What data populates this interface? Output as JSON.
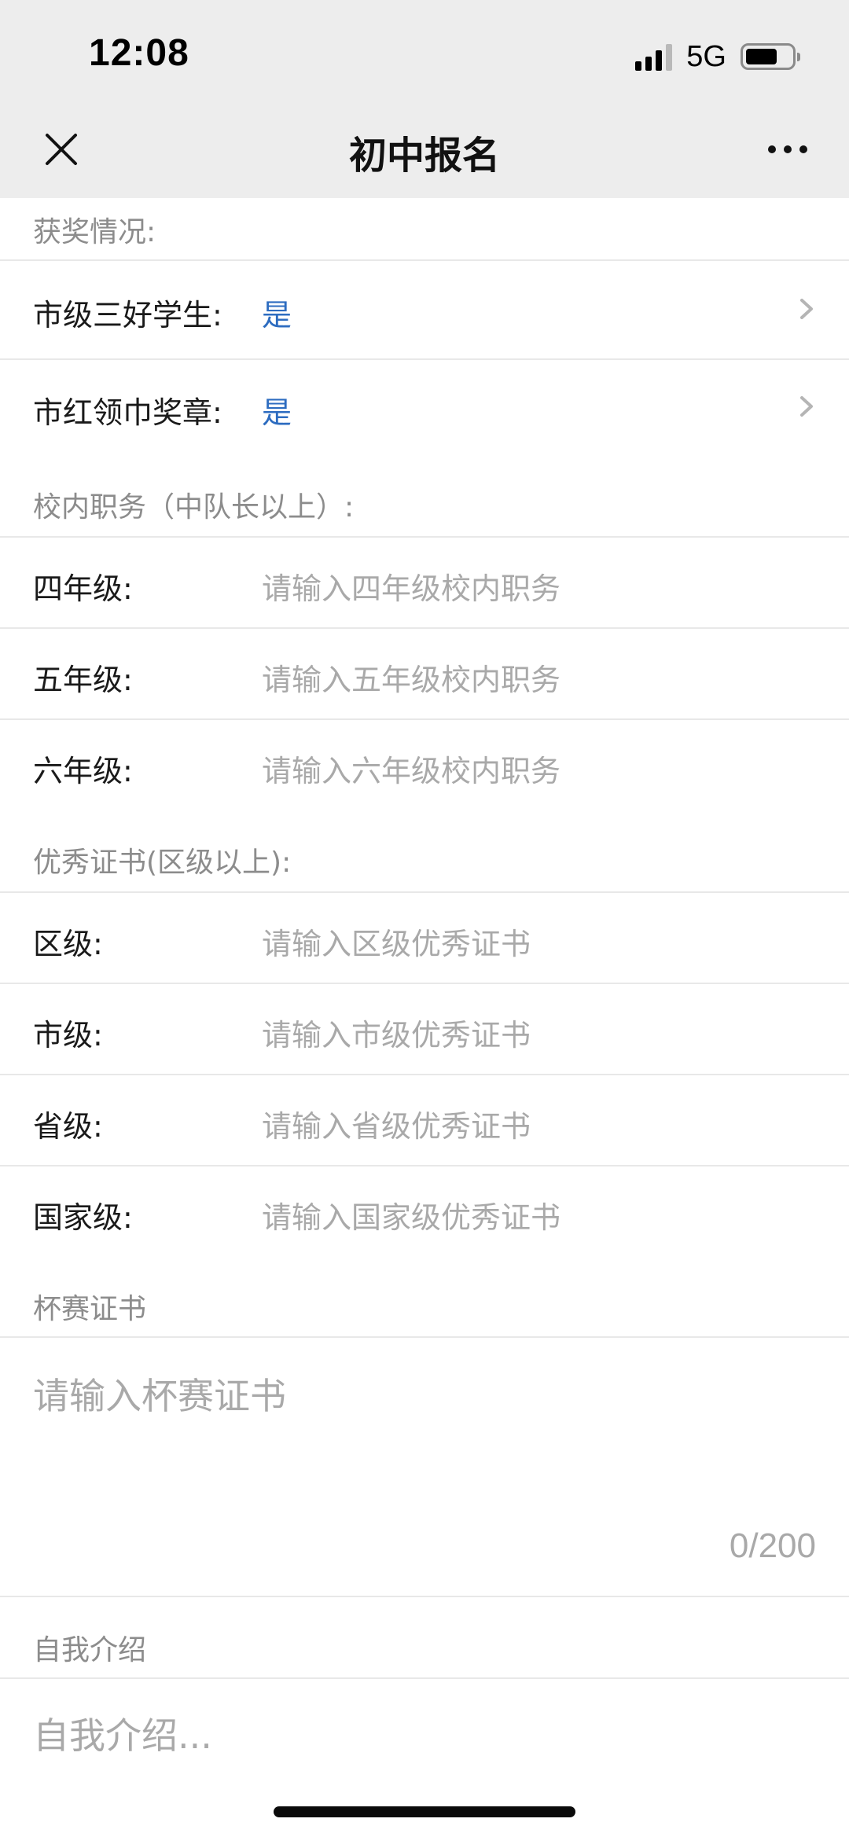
{
  "status_bar": {
    "time": "12:08",
    "network": "5G",
    "battery_level": 0.7
  },
  "nav": {
    "title": "初中报名",
    "close_icon": "close-icon",
    "more_icon": "more-icon"
  },
  "awards": {
    "header": "获奖情况:",
    "rows": [
      {
        "label": "市级三好学生:",
        "value": "是"
      },
      {
        "label": "市红领巾奖章:",
        "value": "是"
      }
    ]
  },
  "duties": {
    "header": "校内职务（中队长以上）:",
    "rows": [
      {
        "label": "四年级:",
        "placeholder": "请输入四年级校内职务"
      },
      {
        "label": "五年级:",
        "placeholder": "请输入五年级校内职务"
      },
      {
        "label": "六年级:",
        "placeholder": "请输入六年级校内职务"
      }
    ]
  },
  "certificates": {
    "header": "优秀证书(区级以上):",
    "rows": [
      {
        "label": "区级:",
        "placeholder": "请输入区级优秀证书"
      },
      {
        "label": "市级:",
        "placeholder": "请输入市级优秀证书"
      },
      {
        "label": "省级:",
        "placeholder": "请输入省级优秀证书"
      },
      {
        "label": "国家级:",
        "placeholder": "请输入国家级优秀证书"
      }
    ]
  },
  "cup": {
    "header": "杯赛证书",
    "placeholder": "请输入杯赛证书",
    "counter": "0/200"
  },
  "intro": {
    "header": "自我介绍",
    "placeholder": "自我介绍..."
  },
  "colors": {
    "accent_blue": "#2d6cc0",
    "placeholder": "#a9a9a9",
    "section_header": "#8c8c8c"
  }
}
